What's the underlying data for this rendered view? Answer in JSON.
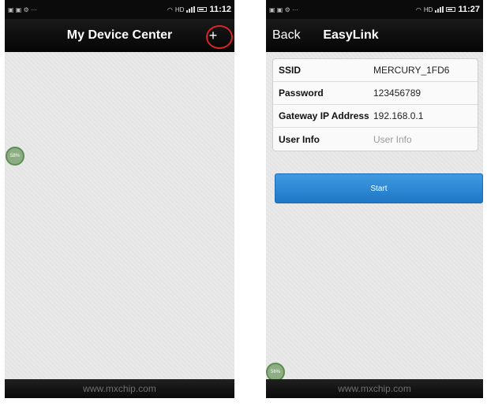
{
  "screen1": {
    "status": {
      "left_icons": "▣ ▣ ⚙ ···",
      "network": "HD",
      "time": "11:12"
    },
    "nav": {
      "title": "My Device Center",
      "add": "+"
    },
    "bubble": "58%",
    "footer": "www.mxchip.com"
  },
  "screen2": {
    "status": {
      "left_icons": "▣ ▣ ⚙ ···",
      "network": "HD",
      "time": "11:27"
    },
    "nav": {
      "back": "Back",
      "title": "EasyLink"
    },
    "form": {
      "ssid_label": "SSID",
      "ssid_value": "MERCURY_1FD6",
      "password_label": "Password",
      "password_value": "123456789",
      "gateway_label": "Gateway IP Address",
      "gateway_value": "192.168.0.1",
      "userinfo_label": "User Info",
      "userinfo_placeholder": "User Info"
    },
    "start_button": "Start",
    "bubble": "56%",
    "footer": "www.mxchip.com"
  },
  "colors": {
    "highlight_circle": "#d9242a",
    "start_button": "#2a86d4",
    "navbar": "#0b0b0b"
  }
}
